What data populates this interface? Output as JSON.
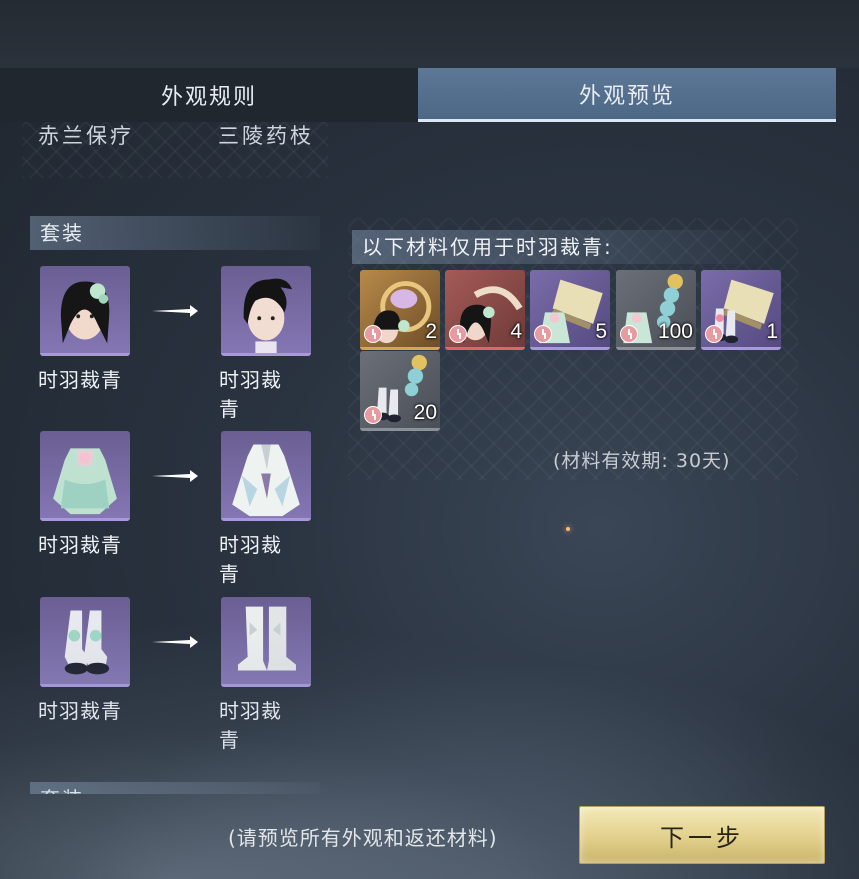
{
  "tabs": [
    {
      "label": "外观规则",
      "active": false
    },
    {
      "label": "外观预览",
      "active": true
    }
  ],
  "left_panel": {
    "cut_off_row": [
      "赤兰保疗",
      "三陵药枝"
    ],
    "section_title": "套装",
    "pairs": [
      {
        "from_label": "时羽裁青",
        "to_label": "时羽裁青",
        "from_icon": "female-head-icon",
        "to_icon": "male-head-icon"
      },
      {
        "from_label": "时羽裁青",
        "to_label": "时羽裁青",
        "from_icon": "green-dress-icon",
        "to_icon": "white-robe-icon"
      },
      {
        "from_label": "时羽裁青",
        "to_label": "时羽裁青",
        "from_icon": "female-shoes-icon",
        "to_icon": "white-boots-icon"
      }
    ],
    "next_section_title_partial": "套装"
  },
  "materials": {
    "header": "以下材料仅用于时羽裁青:",
    "items": [
      {
        "quantity": "2",
        "rarity": "gold",
        "icon": "head-ornament-icon"
      },
      {
        "quantity": "4",
        "rarity": "red",
        "icon": "female-head-icon"
      },
      {
        "quantity": "5",
        "rarity": "purple",
        "icon": "dress-scroll-icon"
      },
      {
        "quantity": "100",
        "rarity": "gray",
        "icon": "dress-pieces-icon"
      },
      {
        "quantity": "1",
        "rarity": "purple",
        "icon": "shoes-scroll-icon"
      },
      {
        "quantity": "20",
        "rarity": "gray",
        "icon": "shoes-pieces-icon"
      }
    ],
    "validity": "(材料有效期: 30天)"
  },
  "footer": {
    "note": "(请预览所有外观和返还材料)",
    "next_button": "下一步"
  }
}
